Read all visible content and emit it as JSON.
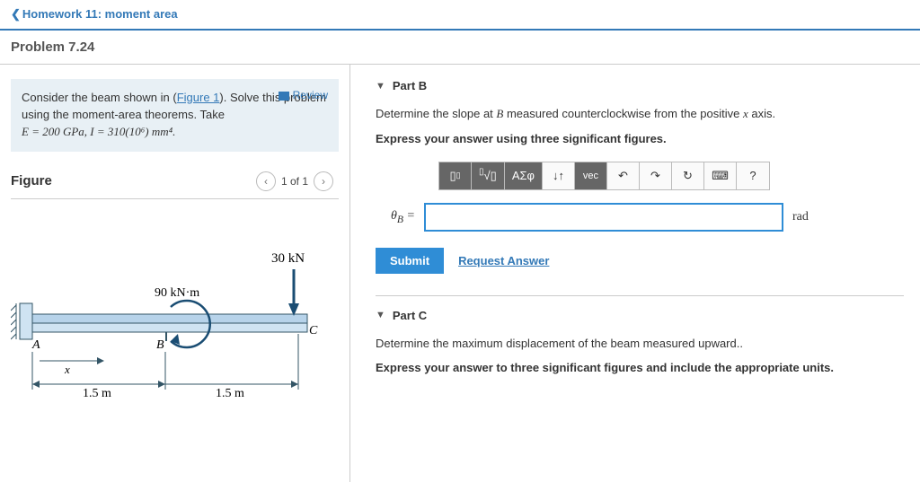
{
  "nav": {
    "back_label": "Homework 11: moment area",
    "problem_title": "Problem 7.24"
  },
  "info": {
    "review_label": "Review",
    "text_prefix": "Consider the beam shown in (",
    "figure_link": "Figure 1",
    "text_mid": "). Solve this problem using the moment-area theorems. Take ",
    "eq_html": "E = 200 GPa, I = 310(10⁶) mm⁴."
  },
  "figure": {
    "title": "Figure",
    "pager_text": "1 of 1",
    "labels": {
      "load": "30 kN",
      "moment": "90 kN·m",
      "A": "A",
      "B": "B",
      "C": "C",
      "x": "x",
      "d1": "1.5 m",
      "d2": "1.5 m"
    }
  },
  "partB": {
    "title": "Part B",
    "desc_pre": "Determine the slope at ",
    "desc_var": "B",
    "desc_post": " measured counterclockwise from the positive ",
    "desc_var2": "x",
    "desc_end": " axis.",
    "instruction": "Express your answer using three significant figures.",
    "toolbar": {
      "templates": "ΑΣφ",
      "updown": "↓↑",
      "vec": "vec",
      "undo": "↶",
      "redo": "↷",
      "reset": "↻",
      "keyboard": "⌨",
      "help": "?"
    },
    "answer_label": "θB =",
    "answer_value": "",
    "unit": "rad",
    "submit": "Submit",
    "request": "Request Answer"
  },
  "partC": {
    "title": "Part C",
    "desc": "Determine the maximum displacement of the beam measured upward..",
    "instruction": "Express your answer to three significant figures and include the appropriate units."
  }
}
